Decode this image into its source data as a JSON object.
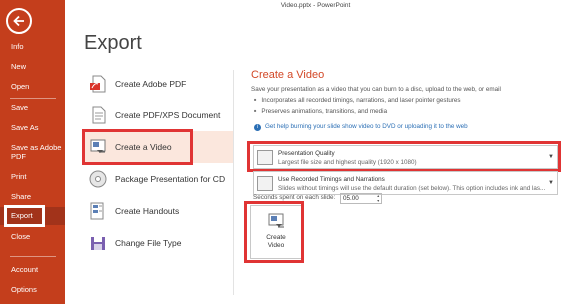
{
  "window": {
    "title": "Video.pptx - PowerPoint"
  },
  "nav": {
    "items": [
      {
        "key": "info",
        "label": "Info"
      },
      {
        "key": "new",
        "label": "New"
      },
      {
        "key": "open",
        "label": "Open"
      },
      {
        "key": "save",
        "label": "Save"
      },
      {
        "key": "save_as",
        "label": "Save As"
      },
      {
        "key": "save_adobe",
        "label": "Save as Adobe PDF"
      },
      {
        "key": "print",
        "label": "Print"
      },
      {
        "key": "share",
        "label": "Share"
      },
      {
        "key": "export",
        "label": "Export"
      },
      {
        "key": "close",
        "label": "Close"
      },
      {
        "key": "account",
        "label": "Account"
      },
      {
        "key": "options",
        "label": "Options"
      }
    ],
    "save_adobe_line1": "Save as Adobe",
    "save_adobe_line2": "PDF"
  },
  "page": {
    "title": "Export"
  },
  "options": [
    {
      "label": "Create Adobe PDF",
      "icon": "adobe-pdf-icon"
    },
    {
      "label": "Create PDF/XPS Document",
      "icon": "pdf-xps-icon"
    },
    {
      "label": "Create a Video",
      "icon": "video-icon"
    },
    {
      "label": "Package Presentation for CD",
      "icon": "cd-icon"
    },
    {
      "label": "Create Handouts",
      "icon": "handouts-icon"
    },
    {
      "label": "Change File Type",
      "icon": "file-type-icon"
    }
  ],
  "detail": {
    "title": "Create a Video",
    "description": "Save your presentation as a video that you can burn to a disc, upload to the web, or email",
    "bullets": [
      "Incorporates all recorded timings, narrations, and laser pointer gestures",
      "Preserves animations, transitions, and media"
    ],
    "help_link": "Get help burning your slide show video to DVD or uploading it to the web",
    "quality": {
      "title": "Presentation Quality",
      "subtitle": "Largest file size and highest quality (1920 x 1080)"
    },
    "timings": {
      "title": "Use Recorded Timings and Narrations",
      "subtitle": "Slides without timings will use the default duration (set below). This option includes ink and las..."
    },
    "seconds_label": "Seconds spent on each slide:",
    "seconds_value": "05.00",
    "create_button_line1": "Create",
    "create_button_line2": "Video"
  },
  "colors": {
    "accent": "#c43e1c",
    "highlight": "#e03434",
    "link": "#2b6fb5"
  }
}
